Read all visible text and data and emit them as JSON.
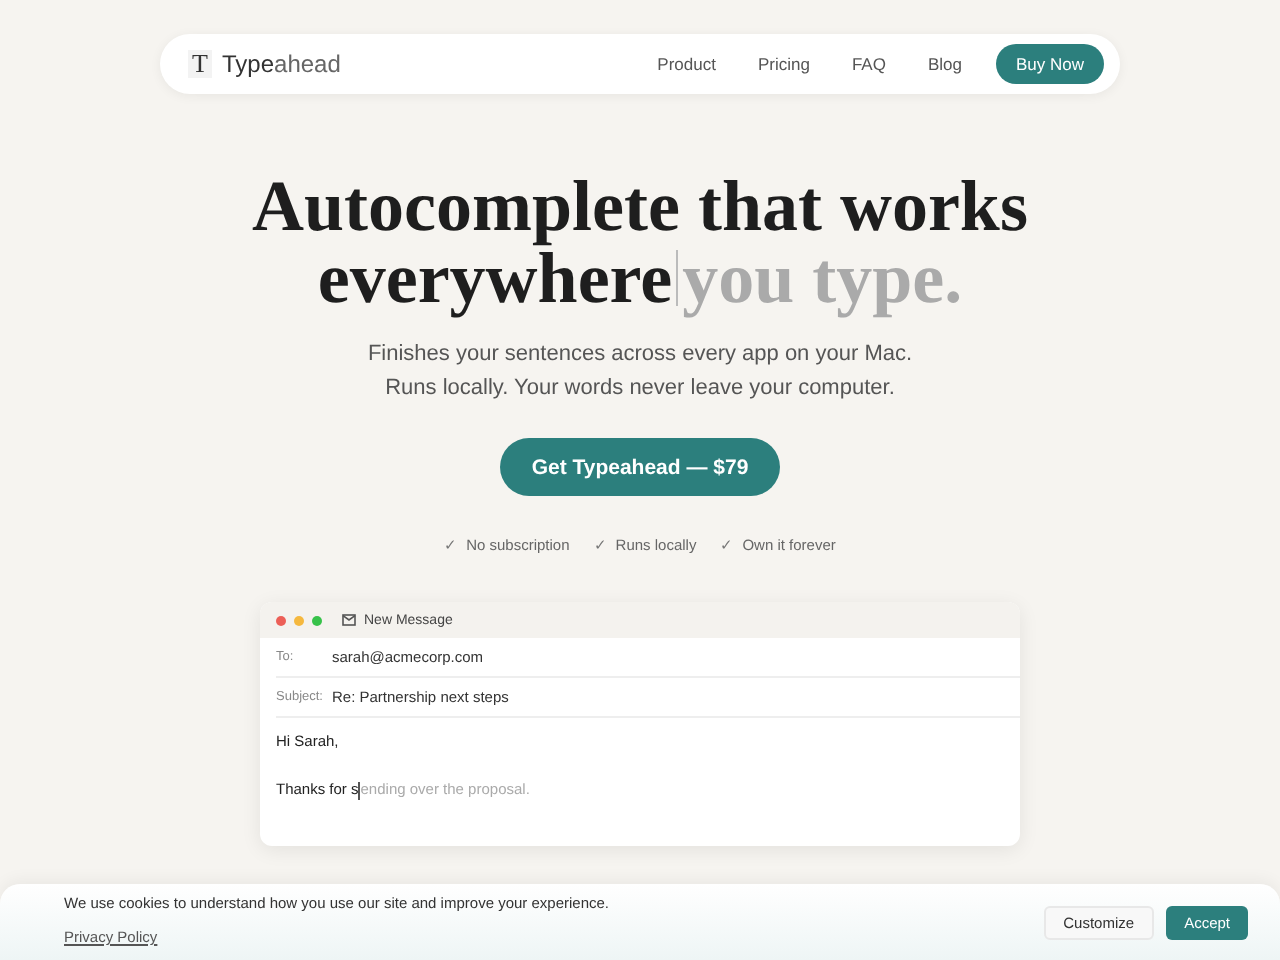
{
  "nav": {
    "logo_mark": "T",
    "brand": "**Type**ahead",
    "links": [
      "Product",
      "Pricing",
      "FAQ",
      "Blog"
    ],
    "cta": "Buy Now"
  },
  "hero": {
    "headline_line1": "Autocomplete that works",
    "headline_typed": "everywhere",
    "headline_suggestion": "you type.",
    "subtitle_lines": [
      "Finishes your sentences across every app on your Mac.",
      "Runs locally. Your words never leave your computer."
    ],
    "cta": "Get Typeahead — $79",
    "features": [
      {
        "check": "✓",
        "label": "No subscription"
      },
      {
        "check": "✓",
        "label": "Runs locally"
      },
      {
        "check": "✓",
        "label": "Own it forever"
      }
    ]
  },
  "demo": {
    "title": "New Message",
    "fields": [
      {
        "label": "To:",
        "value": "sarah@acmecorp.com"
      },
      {
        "label": "Subject:",
        "value": "Re: Partnership next steps"
      }
    ],
    "greeting": "Hi Sarah,",
    "typed": "Thanks for s",
    "suggestion": "ending over the proposal."
  },
  "cookie_banner": {
    "message": "We use cookies to understand how you use our site and improve your experience.",
    "link": "Privacy Policy",
    "buttons": [
      {
        "label": "Customize",
        "kind": "secondary"
      },
      {
        "label": "Accept",
        "kind": "primary"
      }
    ]
  }
}
